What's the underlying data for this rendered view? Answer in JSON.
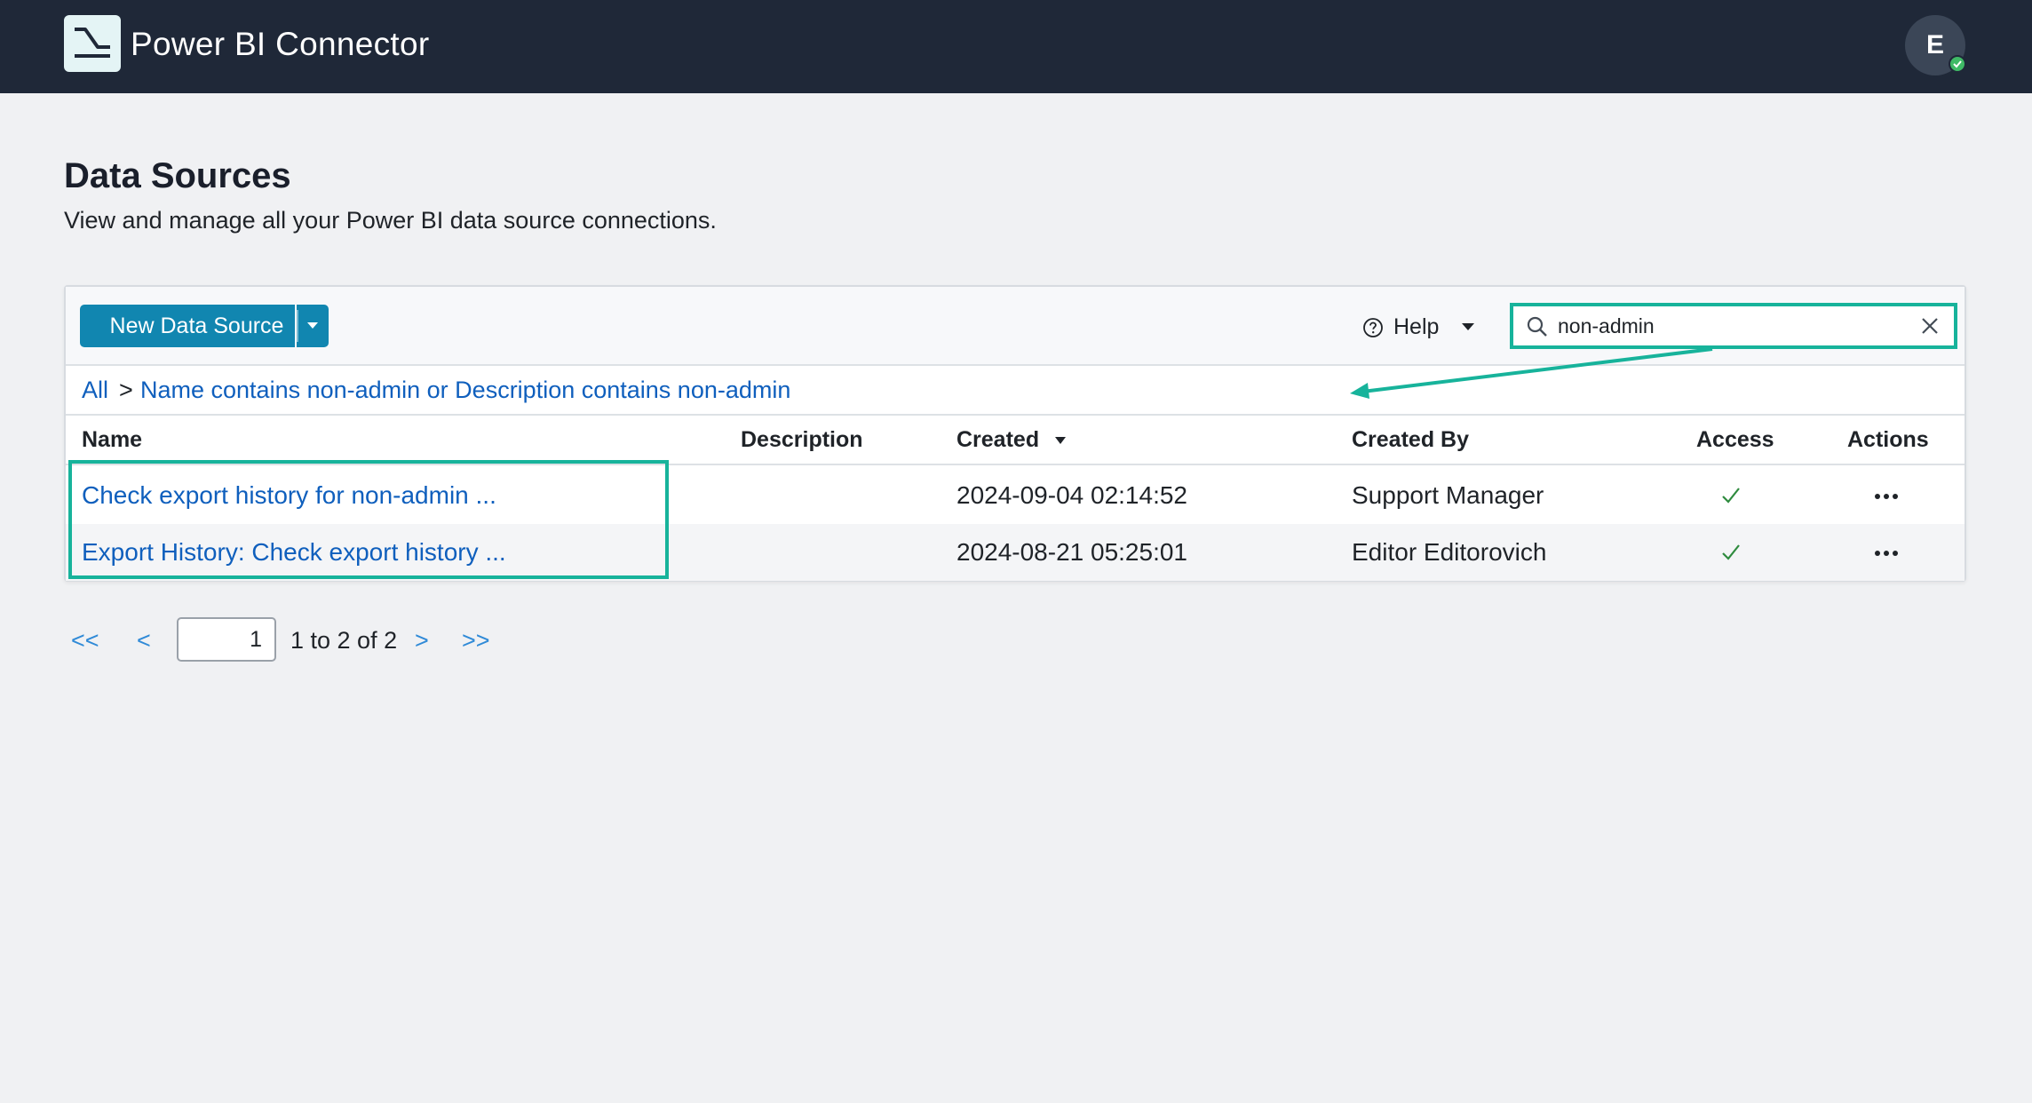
{
  "app": {
    "title": "Power BI Connector",
    "avatar_initial": "E"
  },
  "page": {
    "title": "Data Sources",
    "subtitle": "View and manage all your Power BI data source connections."
  },
  "toolbar": {
    "new_button_label": "New Data Source",
    "help_label": "Help",
    "search_value": "non-admin"
  },
  "filter": {
    "all_label": "All",
    "separator": ">",
    "criteria": "Name contains non-admin or Description contains non-admin"
  },
  "table": {
    "columns": {
      "name": "Name",
      "description": "Description",
      "created": "Created",
      "created_by": "Created By",
      "access": "Access",
      "actions": "Actions"
    },
    "rows": [
      {
        "name": "Check export history for non-admin ...",
        "description": "",
        "created": "2024-09-04 02:14:52",
        "created_by": "Support Manager",
        "access": true
      },
      {
        "name": "Export History: Check export history ...",
        "description": "",
        "created": "2024-08-21 05:25:01",
        "created_by": "Editor Editorovich",
        "access": true
      }
    ]
  },
  "pagination": {
    "first_label": "<<",
    "prev_label": "<",
    "current_page": "1",
    "info": "1 to 2 of 2",
    "next_label": ">",
    "last_label": ">>"
  },
  "colors": {
    "topbar": "#1f2838",
    "primary_button": "#1186b0",
    "link": "#0f5fbd",
    "highlight": "#17b39b",
    "access_check": "#2e8b3e"
  },
  "icons": {
    "logo": "power-bi-connector-logo-icon",
    "search": "search-icon",
    "clear": "close-icon",
    "help": "question-circle-icon",
    "check": "checkmark-icon",
    "more": "more-horizontal-icon",
    "sort": "caret-down-icon"
  }
}
